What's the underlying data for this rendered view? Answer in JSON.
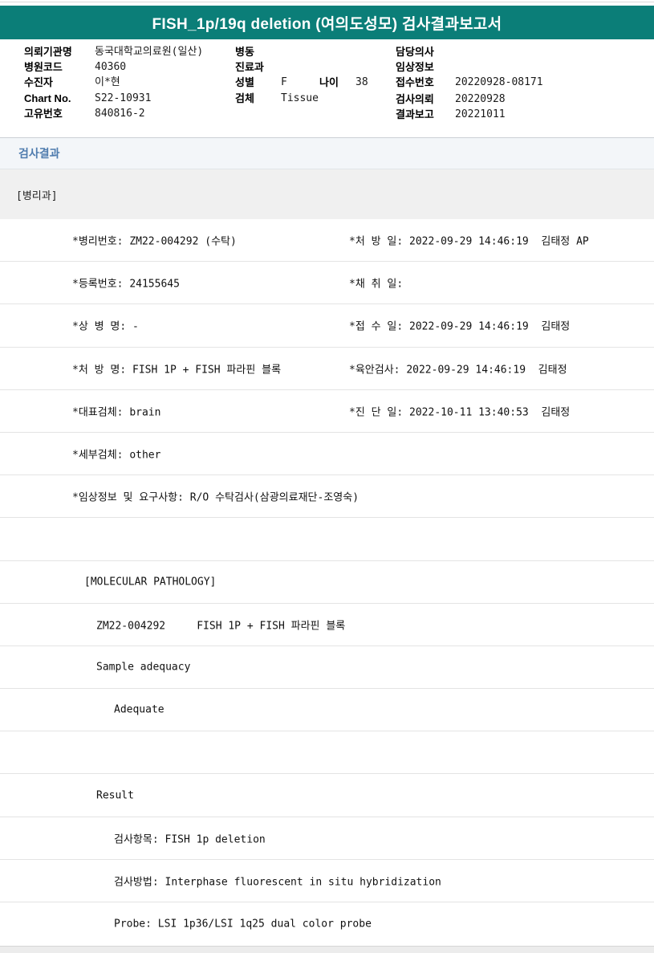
{
  "colors": {
    "header_teal": "#0B7E78",
    "section_title_blue": "#4F7CAE",
    "department_band_gray": "#F0F0F0",
    "footer_gray": "#ECECEC"
  },
  "header": {
    "title": "FISH_1p/19q deletion (여의도성모) 검사결과보고서"
  },
  "patient": {
    "left": [
      {
        "label": "의뢰기관명",
        "value": "동국대학교의료원(일산)"
      },
      {
        "label": "병원코드",
        "value": "40360"
      },
      {
        "label": "수진자",
        "value": "이*현"
      },
      {
        "label": "Chart No.",
        "value": "S22-10931"
      },
      {
        "label": "고유번호",
        "value": "840816-2"
      }
    ],
    "middle": [
      {
        "label": "병동",
        "value": ""
      },
      {
        "label": "진료과",
        "value": ""
      },
      {
        "label": "성별",
        "value": "F"
      },
      {
        "label": "검체",
        "value": "Tissue"
      }
    ],
    "age": {
      "label": "나이",
      "value": "38"
    },
    "right": [
      {
        "label": "담당의사",
        "value": ""
      },
      {
        "label": "임상정보",
        "value": ""
      },
      {
        "label": "접수번호",
        "value": "20220928-08171"
      },
      {
        "label": "검사의뢰",
        "value": "20220928"
      },
      {
        "label": "결과보고",
        "value": "20221011"
      }
    ]
  },
  "section": {
    "title": "검사결과",
    "department": "[병리과]"
  },
  "report": {
    "rows": [
      {
        "left": "*병리번호: ZM22-004292 (수탁)",
        "right": "*처 방 일: 2022-09-29 14:46:19  김태정 AP"
      },
      {
        "left": "*등록번호: 24155645",
        "right": "*채 취 일:"
      },
      {
        "left": "*상 병 명: -",
        "right": "*접 수 일: 2022-09-29 14:46:19  김태정"
      },
      {
        "left": "*처 방 명: FISH 1P + FISH 파라핀 블록",
        "right": "*육안검사: 2022-09-29 14:46:19  김태정"
      },
      {
        "left": "*대표검체: brain",
        "right": "*진 단 일: 2022-10-11 13:40:53  김태정"
      },
      {
        "left": "*세부검체: other",
        "right": ""
      },
      {
        "left": "*임상정보 및 요구사항: R/O 수탁검사(삼광의료재단-조영숙)",
        "right": ""
      },
      {
        "left": "",
        "right": ""
      },
      {
        "left": "[MOLECULAR PATHOLOGY]",
        "right": ""
      },
      {
        "left": "ZM22-004292     FISH 1P + FISH 파라핀 블록",
        "right": ""
      },
      {
        "left": "Sample adequacy",
        "right": ""
      },
      {
        "left": "Adequate",
        "right": ""
      },
      {
        "left": "",
        "right": ""
      },
      {
        "left": "Result",
        "right": ""
      },
      {
        "left": "검사항목: FISH 1p deletion",
        "right": ""
      },
      {
        "left": "검사방법: Interphase fluorescent in situ hybridization",
        "right": ""
      },
      {
        "left": "Probe: LSI 1p36/LSI 1q25 dual color probe",
        "right": ""
      }
    ]
  }
}
